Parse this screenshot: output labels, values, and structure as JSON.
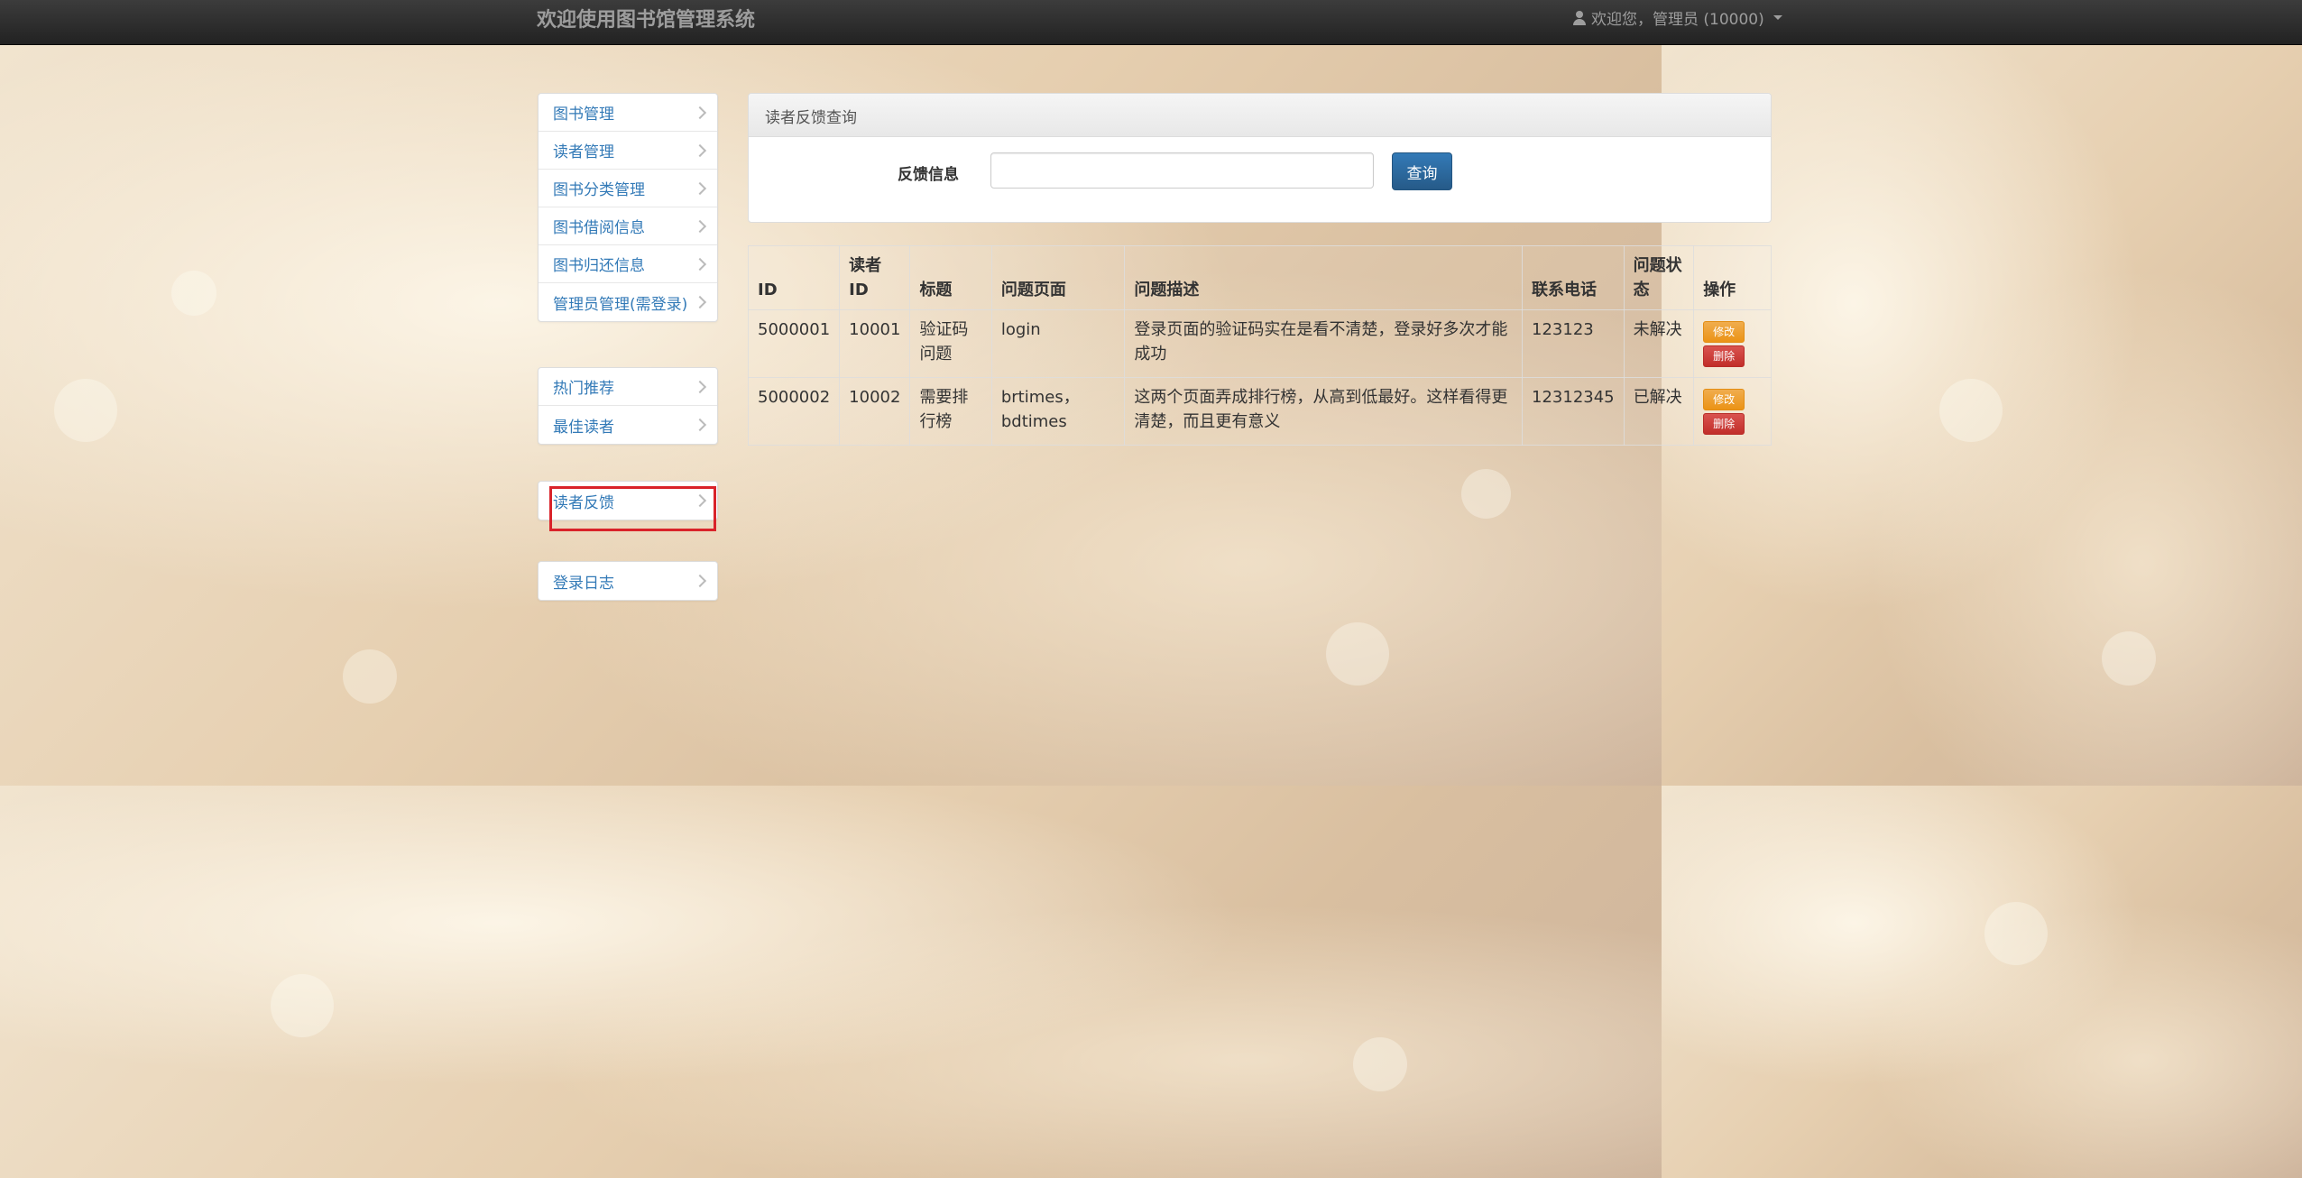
{
  "navbar": {
    "brand": "欢迎使用图书馆管理系统",
    "user": "欢迎您，管理员 (10000)"
  },
  "sidebar": {
    "groups": [
      {
        "items": [
          {
            "label": "图书管理"
          },
          {
            "label": "读者管理"
          },
          {
            "label": "图书分类管理"
          },
          {
            "label": "图书借阅信息"
          },
          {
            "label": "图书归还信息"
          },
          {
            "label": "管理员管理(需登录)"
          }
        ]
      },
      {
        "items": [
          {
            "label": "热门推荐"
          },
          {
            "label": "最佳读者"
          }
        ]
      },
      {
        "items": [
          {
            "label": "读者反馈",
            "highlighted": true
          }
        ]
      },
      {
        "items": [
          {
            "label": "登录日志"
          }
        ]
      }
    ],
    "highlight_color": "#d9232a"
  },
  "query_panel": {
    "title": "读者反馈查询",
    "field_label": "反馈信息",
    "field_value": "",
    "button_label": "查询"
  },
  "table": {
    "headers": [
      "ID",
      "读者ID",
      "标题",
      "问题页面",
      "问题描述",
      "联系电话",
      "问题状态",
      "操作"
    ],
    "rows": [
      {
        "id": "5000001",
        "reader_id": "10001",
        "title": "验证码问题",
        "page": "login",
        "description": "登录页面的验证码实在是看不清楚，登录好多次才能成功",
        "phone": "123123",
        "status": "未解决",
        "edit": "修改",
        "delete": "删除"
      },
      {
        "id": "5000002",
        "reader_id": "10002",
        "title": "需要排行榜",
        "page": "brtimes，bdtimes",
        "description": "这两个页面弄成排行榜，从高到低最好。这样看得更清楚，而且更有意义",
        "phone": "12312345",
        "status": "已解决",
        "edit": "修改",
        "delete": "删除"
      }
    ]
  },
  "colors": {
    "navbar": "#222222",
    "link": "#337ab7",
    "primary_button": "#337ab7",
    "warning_button": "#f0ad4e",
    "danger_button": "#d9534f"
  }
}
